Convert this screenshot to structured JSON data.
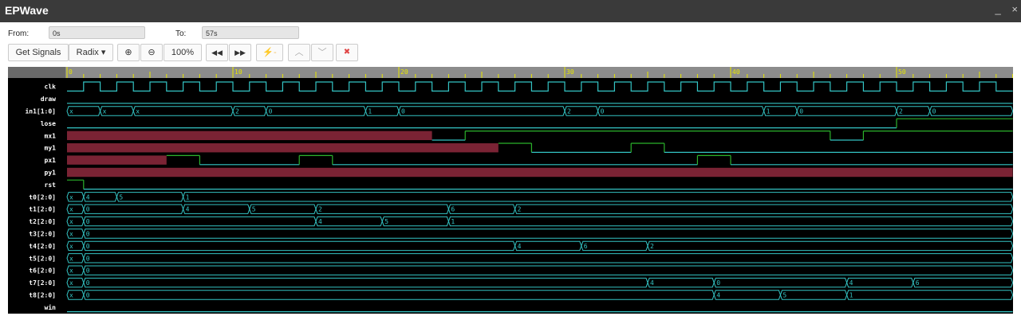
{
  "app": {
    "title": "EPWave"
  },
  "window": {
    "minimize": "_",
    "close": "×"
  },
  "range": {
    "from_label": "From:",
    "from_value": "0s",
    "to_label": "To:",
    "to_value": "57s"
  },
  "toolbar": {
    "get_signals": "Get Signals",
    "radix": "Radix ▾",
    "zoom_in": "⊕",
    "zoom_out": "⊖",
    "zoom_level": "100%",
    "rewind": "◀◀",
    "forward": "▶▶",
    "edge": "⚡-",
    "up": "︿",
    "down": "﹀",
    "remove": "✖"
  },
  "colors": {
    "wave": "#34c4c4",
    "x_fill": "#7a2334",
    "edge_green": "#2bb32b",
    "ruler": "#8c8c8c",
    "tick": "#e6e600"
  },
  "timeline": {
    "end": 57,
    "major_ticks": [
      0,
      10,
      20,
      30,
      40,
      50
    ]
  },
  "signals": [
    {
      "name": "clk",
      "kind": "clock",
      "period": 2
    },
    {
      "name": "draw",
      "kind": "bit",
      "segments": [
        [
          0,
          57,
          "0"
        ]
      ]
    },
    {
      "name": "in1[1:0]",
      "kind": "bus",
      "segments": [
        [
          0,
          2,
          "x"
        ],
        [
          2,
          4,
          "x"
        ],
        [
          4,
          10,
          "x"
        ],
        [
          10,
          12,
          "2"
        ],
        [
          12,
          18,
          "0"
        ],
        [
          18,
          20,
          "1"
        ],
        [
          20,
          30,
          "0"
        ],
        [
          30,
          32,
          "2"
        ],
        [
          32,
          42,
          "0"
        ],
        [
          42,
          44,
          "1"
        ],
        [
          44,
          50,
          "0"
        ],
        [
          50,
          52,
          "2"
        ],
        [
          52,
          57,
          "0"
        ]
      ]
    },
    {
      "name": "lose",
      "kind": "bit",
      "segments": [
        [
          0,
          50,
          "0"
        ],
        [
          50,
          57,
          "1"
        ]
      ]
    },
    {
      "name": "mx1",
      "kind": "bit",
      "segments": [
        [
          0,
          22,
          "X"
        ],
        [
          22,
          24,
          "0"
        ],
        [
          24,
          46,
          "1"
        ],
        [
          46,
          48,
          "0"
        ],
        [
          48,
          57,
          "1"
        ]
      ]
    },
    {
      "name": "my1",
      "kind": "bit",
      "segments": [
        [
          0,
          26,
          "X"
        ],
        [
          26,
          28,
          "1"
        ],
        [
          28,
          34,
          "0"
        ],
        [
          34,
          36,
          "1"
        ],
        [
          36,
          57,
          "0"
        ]
      ]
    },
    {
      "name": "px1",
      "kind": "bit",
      "segments": [
        [
          0,
          6,
          "X"
        ],
        [
          6,
          8,
          "1"
        ],
        [
          8,
          14,
          "0"
        ],
        [
          14,
          16,
          "1"
        ],
        [
          16,
          38,
          "0"
        ],
        [
          38,
          40,
          "1"
        ],
        [
          40,
          57,
          "0"
        ]
      ]
    },
    {
      "name": "py1",
      "kind": "bit",
      "segments": [
        [
          0,
          57,
          "X"
        ]
      ]
    },
    {
      "name": "rst",
      "kind": "bit",
      "segments": [
        [
          0,
          1,
          "1"
        ],
        [
          1,
          57,
          "0"
        ]
      ]
    },
    {
      "name": "t0[2:0]",
      "kind": "bus",
      "segments": [
        [
          0,
          1,
          "x"
        ],
        [
          1,
          3,
          "4"
        ],
        [
          3,
          7,
          "5"
        ],
        [
          7,
          57,
          "1"
        ]
      ]
    },
    {
      "name": "t1[2:0]",
      "kind": "bus",
      "segments": [
        [
          0,
          1,
          "x"
        ],
        [
          1,
          7,
          "0"
        ],
        [
          7,
          11,
          "4"
        ],
        [
          11,
          15,
          "5"
        ],
        [
          15,
          23,
          "2"
        ],
        [
          23,
          27,
          "6"
        ],
        [
          27,
          57,
          "2"
        ]
      ]
    },
    {
      "name": "t2[2:0]",
      "kind": "bus",
      "segments": [
        [
          0,
          1,
          "x"
        ],
        [
          1,
          15,
          "0"
        ],
        [
          15,
          19,
          "4"
        ],
        [
          19,
          23,
          "5"
        ],
        [
          23,
          57,
          "1"
        ]
      ]
    },
    {
      "name": "t3[2:0]",
      "kind": "bus",
      "segments": [
        [
          0,
          1,
          "x"
        ],
        [
          1,
          57,
          "0"
        ]
      ]
    },
    {
      "name": "t4[2:0]",
      "kind": "bus",
      "segments": [
        [
          0,
          1,
          "x"
        ],
        [
          1,
          27,
          "0"
        ],
        [
          27,
          31,
          "4"
        ],
        [
          31,
          35,
          "6"
        ],
        [
          35,
          57,
          "2"
        ]
      ]
    },
    {
      "name": "t5[2:0]",
      "kind": "bus",
      "segments": [
        [
          0,
          1,
          "x"
        ],
        [
          1,
          57,
          "0"
        ]
      ]
    },
    {
      "name": "t6[2:0]",
      "kind": "bus",
      "segments": [
        [
          0,
          1,
          "x"
        ],
        [
          1,
          57,
          "0"
        ]
      ]
    },
    {
      "name": "t7[2:0]",
      "kind": "bus",
      "segments": [
        [
          0,
          1,
          "x"
        ],
        [
          1,
          35,
          "0"
        ],
        [
          35,
          39,
          "4"
        ],
        [
          39,
          47,
          "0"
        ],
        [
          47,
          51,
          "4"
        ],
        [
          51,
          57,
          "6"
        ]
      ]
    },
    {
      "name": "t8[2:0]",
      "kind": "bus",
      "segments": [
        [
          0,
          1,
          "x"
        ],
        [
          1,
          39,
          "0"
        ],
        [
          39,
          43,
          "4"
        ],
        [
          43,
          47,
          "5"
        ],
        [
          47,
          57,
          "1"
        ]
      ]
    },
    {
      "name": "win",
      "kind": "bit",
      "segments": [
        [
          0,
          57,
          "0"
        ]
      ]
    }
  ]
}
